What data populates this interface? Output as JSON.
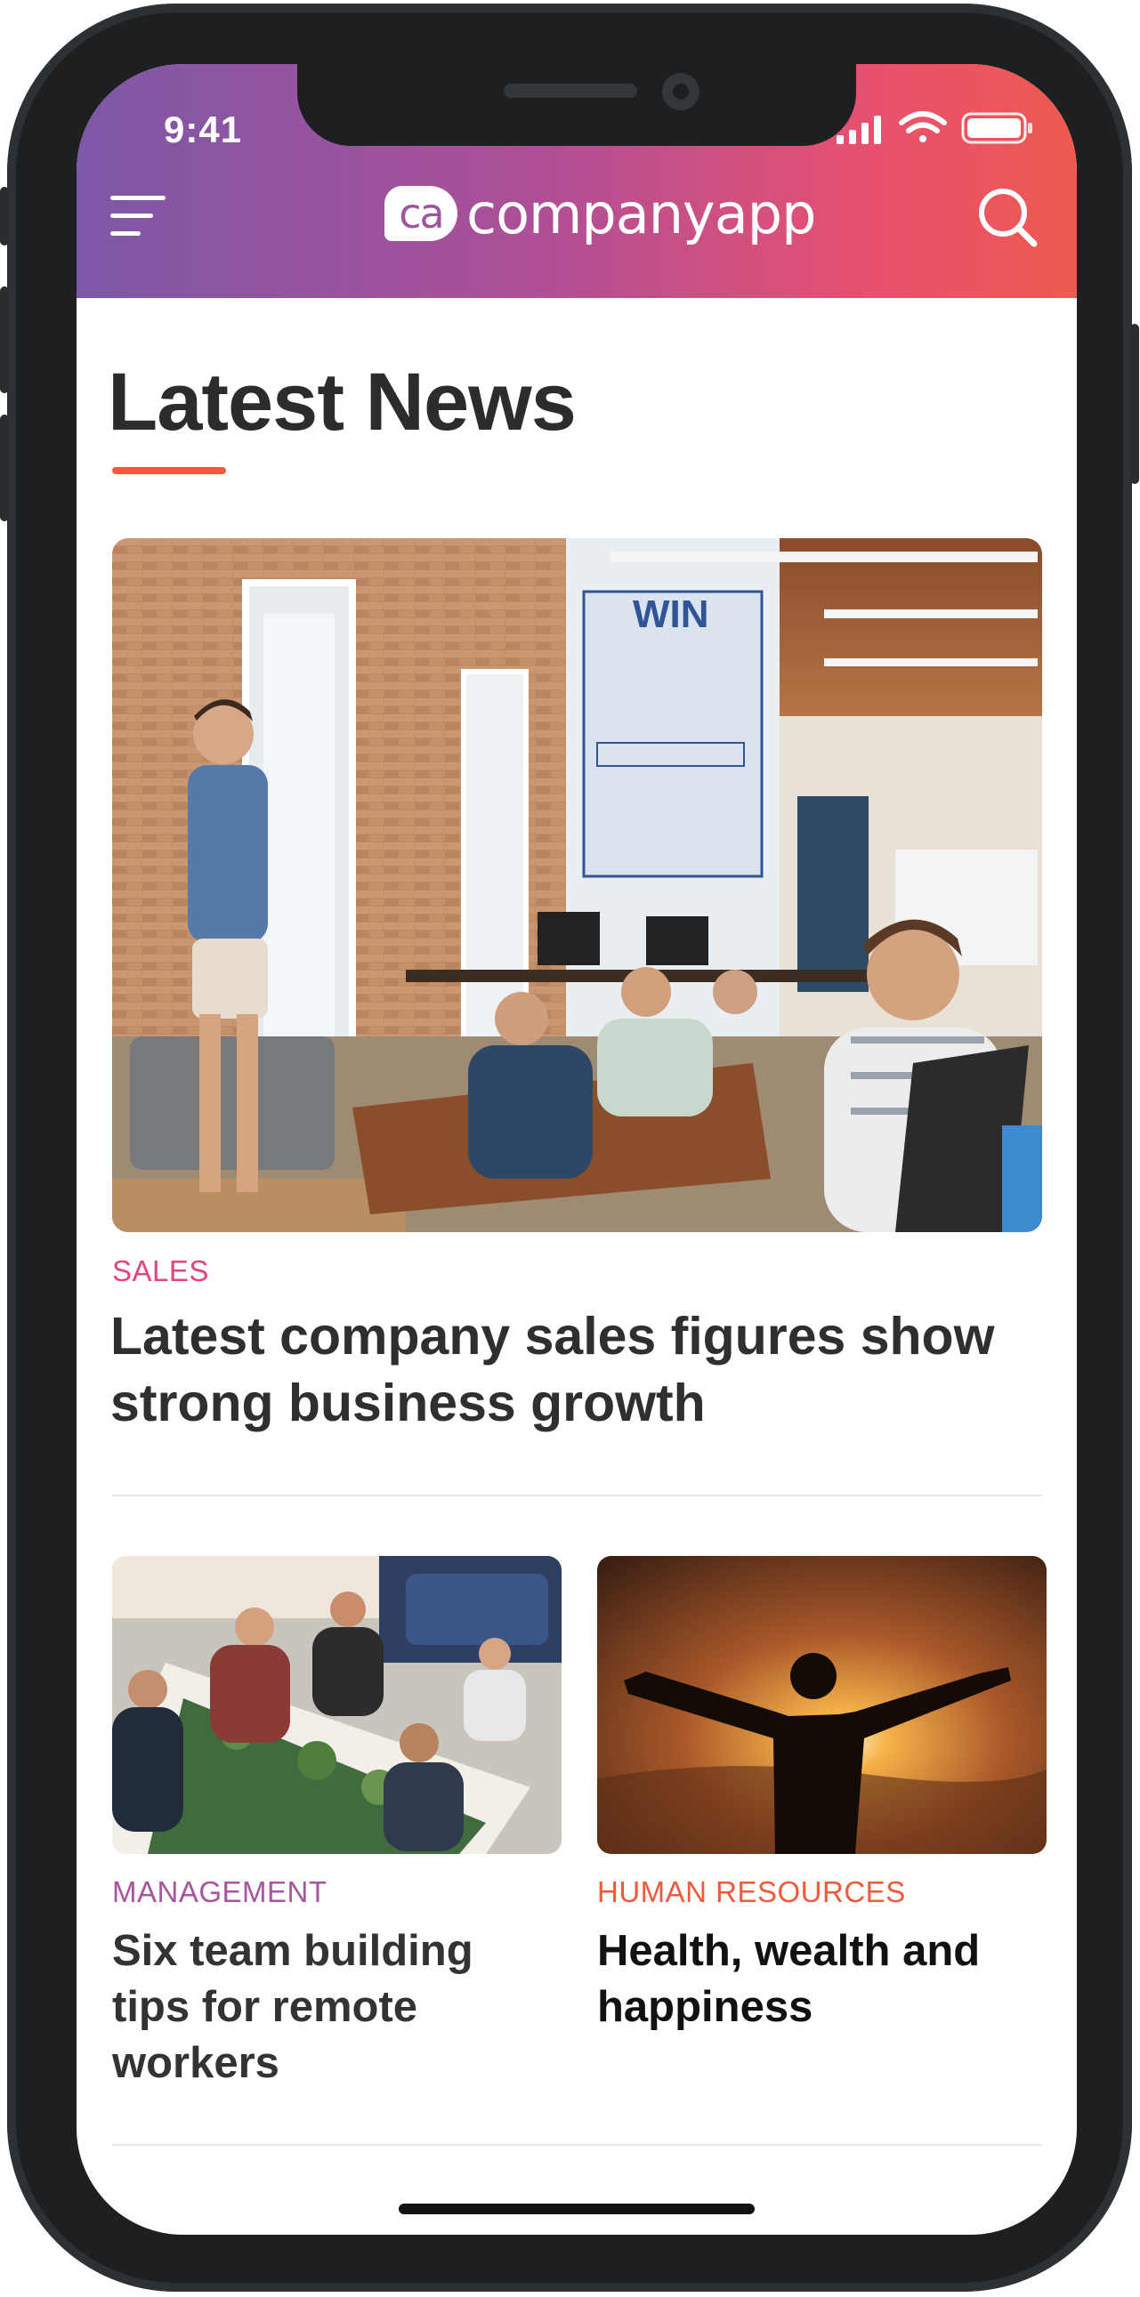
{
  "status_bar": {
    "time": "9:41"
  },
  "header": {
    "logo_badge": "ca",
    "logo_text": "companyapp",
    "gradient": [
      "#7c58a6",
      "#ad4f98",
      "#e9506e",
      "#ee5a50"
    ]
  },
  "icons": {
    "menu": "hamburger-menu-icon",
    "search": "search-icon",
    "signal": "cellular-signal-icon",
    "wifi": "wifi-icon",
    "battery": "battery-icon"
  },
  "section": {
    "title": "Latest News",
    "accent_color": "#ee5a3a"
  },
  "featured": {
    "category": "SALES",
    "category_color": "#e0457b",
    "title": "Latest company sales figures show strong business growth",
    "image": "office-presentation-photo"
  },
  "cards": [
    {
      "category": "MANAGEMENT",
      "category_color": "#a8549e",
      "title": "Six team building tips for remote workers",
      "image": "team-workshop-photo"
    },
    {
      "category": "HUMAN RESOURCES",
      "category_color": "#ee5a3a",
      "title": "Health, wealth and happiness",
      "image": "sunset-silhouette-photo"
    }
  ]
}
